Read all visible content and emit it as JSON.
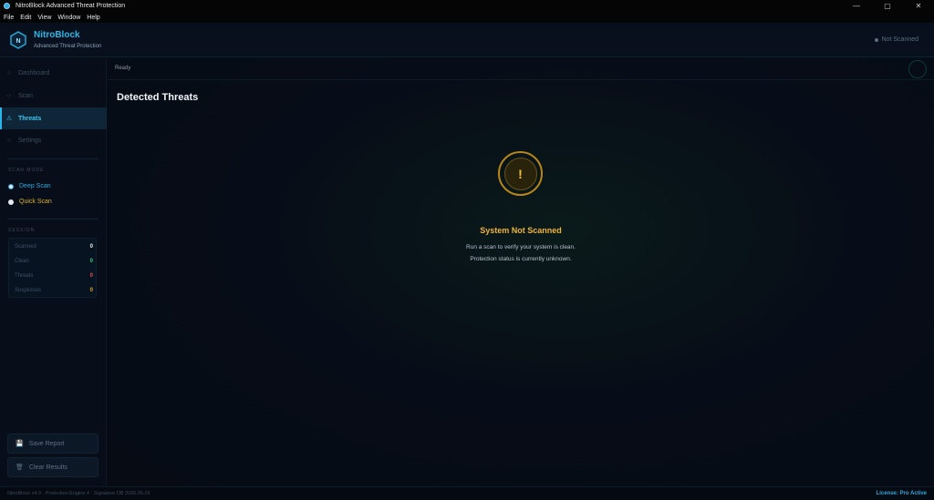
{
  "window": {
    "title": "NitroBlock Advanced Threat Protection",
    "controls": {
      "minimize": "—",
      "maximize": "▢",
      "close": "✕"
    }
  },
  "menu": [
    "File",
    "Edit",
    "View",
    "Window",
    "Help"
  ],
  "header": {
    "brand": "NitroBlock",
    "subtitle": "Advanced Threat Protection",
    "logo_letter": "N",
    "scan_status": "Not Scanned"
  },
  "sidebar": {
    "nav": [
      {
        "label": "Dashboard",
        "icon": "circle-icon",
        "glyph": "○"
      },
      {
        "label": "Scan",
        "icon": "circle-icon",
        "glyph": "○"
      },
      {
        "label": "Threats",
        "icon": "warning-icon",
        "glyph": "⚠"
      },
      {
        "label": "Settings",
        "icon": "circle-icon",
        "glyph": "○"
      }
    ],
    "scan_mode_label": "SCAN MODE",
    "scan_modes": [
      "Deep Scan",
      "Quick Scan"
    ],
    "session_label": "SESSION",
    "stats": [
      {
        "label": "Scanned",
        "value": "0"
      },
      {
        "label": "Clean",
        "value": "0"
      },
      {
        "label": "Threats",
        "value": "0"
      },
      {
        "label": "Suspicious",
        "value": "0"
      }
    ],
    "save_report": "Save Report",
    "clear_results": "Clear Results"
  },
  "main": {
    "ready": "Ready",
    "title": "Detected Threats",
    "warning_glyph": "!",
    "status_title": "System Not Scanned",
    "status_line1": "Run a scan to verify your system is clean.",
    "status_line2": "Protection status is currently unknown."
  },
  "footer": {
    "left": "NitroBlock v4.3 · Protection Engine 4 · Signature DB 2026.06.15",
    "right": "License: Pro Active"
  },
  "colors": {
    "accent": "#28b7e8",
    "warning": "#f0b431",
    "clean": "#2ecc71",
    "threat": "#e35151"
  }
}
